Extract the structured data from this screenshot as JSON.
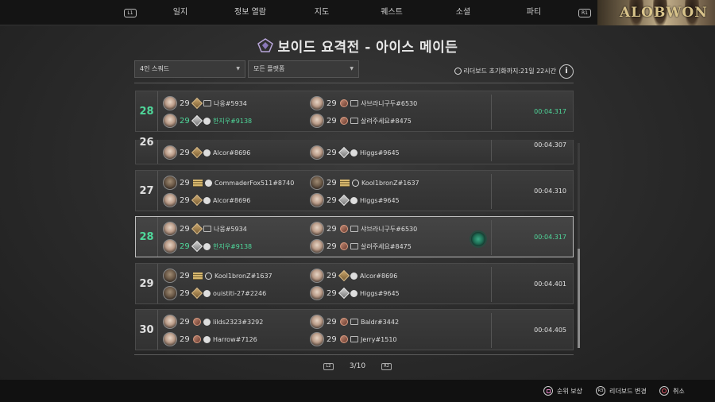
{
  "nav": {
    "left_shoulder": "L1",
    "right_shoulder": "R1",
    "tabs": [
      {
        "label": "일지",
        "active": true
      },
      {
        "label": "정보 열람",
        "active": false
      },
      {
        "label": "지도",
        "active": false
      },
      {
        "label": "퀘스트",
        "active": false
      },
      {
        "label": "소셜",
        "active": false
      },
      {
        "label": "파티",
        "active": false
      }
    ],
    "promo_text": "ALOBWON"
  },
  "title": "보이드 요격전 - 아이스 메이든",
  "filters": {
    "squad": "4인 스쿼드",
    "platform": "모든 플랫폼"
  },
  "reset_info": "리더보드 초기화까지:21일 22시간",
  "info_icon": "i",
  "rows": [
    {
      "rank": "28",
      "rank_green": true,
      "time": "00:04.317",
      "time_green": true,
      "players": [
        {
          "level": "29",
          "name": "나옹#5934",
          "badge": "diamond",
          "platform": "pc",
          "green": false
        },
        {
          "level": "29",
          "name": "샤브라니구두#6530",
          "badge": "bronze",
          "platform": "pc",
          "green": false
        },
        {
          "level": "29",
          "name": "한지우#9138",
          "badge": "silver",
          "platform": "ps",
          "green": true
        },
        {
          "level": "29",
          "name": "살려주세요#8475",
          "badge": "bronze",
          "platform": "pc",
          "green": false
        }
      ]
    },
    {
      "rank": "26",
      "rank_green": false,
      "time": "00:04.307",
      "time_green": false,
      "players": [
        {
          "level": "29",
          "name": "Alcor#8696",
          "badge": "diamond",
          "platform": "ps",
          "green": false
        },
        {
          "level": "29",
          "name": "Higgs#9645",
          "badge": "silver",
          "platform": "ps",
          "green": false
        }
      ]
    },
    {
      "rank": "27",
      "rank_green": false,
      "time": "00:04.310",
      "time_green": false,
      "players": [
        {
          "level": "29",
          "name": "CommaderFox511#8740",
          "badge": "wing",
          "platform": "ps",
          "green": false
        },
        {
          "level": "29",
          "name": "Kool1bronZ#1637",
          "badge": "wing",
          "platform": "xbox",
          "green": false
        },
        {
          "level": "29",
          "name": "Alcor#8696",
          "badge": "diamond",
          "platform": "ps",
          "green": false
        },
        {
          "level": "29",
          "name": "Higgs#9645",
          "badge": "silver",
          "platform": "ps",
          "green": false
        }
      ]
    },
    {
      "rank": "28",
      "rank_green": true,
      "time": "00:04.317",
      "time_green": true,
      "players": [
        {
          "level": "29",
          "name": "나옹#5934",
          "badge": "diamond",
          "platform": "pc",
          "green": false
        },
        {
          "level": "29",
          "name": "샤브라니구두#6530",
          "badge": "bronze",
          "platform": "pc",
          "green": false
        },
        {
          "level": "29",
          "name": "한지우#9138",
          "badge": "silver",
          "platform": "ps",
          "green": true
        },
        {
          "level": "29",
          "name": "살려주세요#8475",
          "badge": "bronze",
          "platform": "pc",
          "green": false
        }
      ]
    },
    {
      "rank": "29",
      "rank_green": false,
      "time": "00:04.401",
      "time_green": false,
      "players": [
        {
          "level": "29",
          "name": "Kool1bronZ#1637",
          "badge": "wing",
          "platform": "xbox",
          "green": false
        },
        {
          "level": "29",
          "name": "Alcor#8696",
          "badge": "diamond",
          "platform": "ps",
          "green": false
        },
        {
          "level": "29",
          "name": "ouistiti-27#2246",
          "badge": "diamond",
          "platform": "ps",
          "green": false
        },
        {
          "level": "29",
          "name": "Higgs#9645",
          "badge": "silver",
          "platform": "ps",
          "green": false
        }
      ]
    },
    {
      "rank": "30",
      "rank_green": false,
      "time": "00:04.405",
      "time_green": false,
      "players": [
        {
          "level": "29",
          "name": "lilds2323#3292",
          "badge": "bronze",
          "platform": "ps",
          "green": false
        },
        {
          "level": "29",
          "name": "Baldr#3442",
          "badge": "bronze",
          "platform": "pc",
          "green": false
        },
        {
          "level": "29",
          "name": "Harrow#7126",
          "badge": "bronze",
          "platform": "ps",
          "green": false
        },
        {
          "level": "29",
          "name": "Jerry#1510",
          "badge": "bronze",
          "platform": "pc",
          "green": false
        }
      ]
    }
  ],
  "pager": {
    "prev_button": "L2",
    "next_button": "R2",
    "page": "3/10"
  },
  "hints": [
    {
      "button": "square",
      "label": "순위 보상"
    },
    {
      "button": "R3",
      "label": "리더보드 변경"
    },
    {
      "button": "circle",
      "label": "취소"
    }
  ]
}
